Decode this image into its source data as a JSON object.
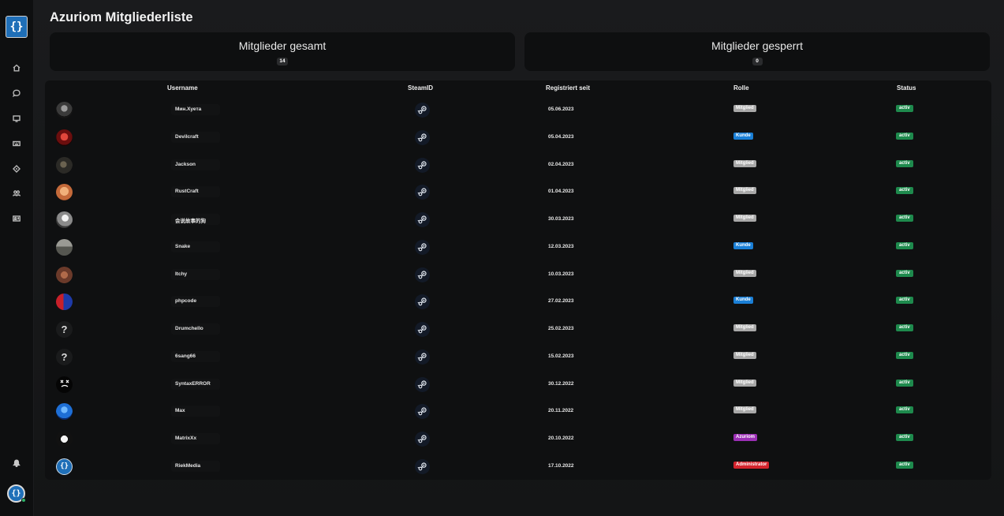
{
  "sidebar": {
    "logo_glyph": "{}",
    "nav_icons": [
      "home-icon",
      "chat-icon",
      "monitor-icon",
      "keyboard-icon",
      "diamond-icon",
      "users-icon",
      "id-card-icon"
    ],
    "bottom_icons": [
      "bell-icon"
    ],
    "user_avatar_glyph": "{}"
  },
  "page": {
    "title": "Azuriom Mitgliederliste"
  },
  "stats": {
    "total": {
      "label": "Mitglieder gesamt",
      "count": "14"
    },
    "banned": {
      "label": "Mitglieder gesperrt",
      "count": "0"
    }
  },
  "table": {
    "headers": {
      "username": "Username",
      "steamid": "SteamID",
      "registered": "Registriert seit",
      "role": "Rolle",
      "status": "Status"
    },
    "rows": [
      {
        "username": "Мин.Хуета",
        "date": "05.06.2023",
        "role": "Mitglied",
        "role_color": "#a8a8a8",
        "status": "activ",
        "avatar": "dark-portrait",
        "avatar_text": ""
      },
      {
        "username": "Devilcraft",
        "date": "05.04.2023",
        "role": "Kunde",
        "role_color": "#1a7fd6",
        "status": "activ",
        "avatar": "red-devil",
        "avatar_text": ""
      },
      {
        "username": "Jackson",
        "date": "02.04.2023",
        "role": "Mitglied",
        "role_color": "#a8a8a8",
        "status": "activ",
        "avatar": "dark-figure",
        "avatar_text": ""
      },
      {
        "username": "RustCraft",
        "date": "01.04.2023",
        "role": "Mitglied",
        "role_color": "#a8a8a8",
        "status": "activ",
        "avatar": "orange-face",
        "avatar_text": ""
      },
      {
        "username": "会说故事的狗",
        "date": "30.03.2023",
        "role": "Mitglied",
        "role_color": "#a8a8a8",
        "status": "activ",
        "avatar": "sketch-portrait",
        "avatar_text": ""
      },
      {
        "username": "Snake",
        "date": "12.03.2023",
        "role": "Kunde",
        "role_color": "#1a7fd6",
        "status": "activ",
        "avatar": "grey-landscape",
        "avatar_text": ""
      },
      {
        "username": "Itchy",
        "date": "10.03.2023",
        "role": "Mitglied",
        "role_color": "#a8a8a8",
        "status": "activ",
        "avatar": "brown-scene",
        "avatar_text": ""
      },
      {
        "username": "phpcode",
        "date": "27.02.2023",
        "role": "Kunde",
        "role_color": "#1a7fd6",
        "status": "activ",
        "avatar": "red-blue-hero",
        "avatar_text": ""
      },
      {
        "username": "Drumchello",
        "date": "25.02.2023",
        "role": "Mitglied",
        "role_color": "#a8a8a8",
        "status": "activ",
        "avatar": "unknown",
        "avatar_text": "?"
      },
      {
        "username": "6sang66",
        "date": "15.02.2023",
        "role": "Mitglied",
        "role_color": "#a8a8a8",
        "status": "activ",
        "avatar": "unknown",
        "avatar_text": "?"
      },
      {
        "username": "SyntaxERROR",
        "date": "30.12.2022",
        "role": "Mitglied",
        "role_color": "#a8a8a8",
        "status": "activ",
        "avatar": "x-eyes-face",
        "avatar_text": ""
      },
      {
        "username": "Max",
        "date": "20.11.2022",
        "role": "Mitglied",
        "role_color": "#a8a8a8",
        "status": "activ",
        "avatar": "blue-figure",
        "avatar_text": ""
      },
      {
        "username": "MatrixXx",
        "date": "20.10.2022",
        "role": "Azuriom",
        "role_color": "#9b2fb5",
        "status": "activ",
        "avatar": "white-mask",
        "avatar_text": ""
      },
      {
        "username": "RiekMedia",
        "date": "17.10.2022",
        "role": "Administrator",
        "role_color": "#d3242d",
        "status": "activ",
        "avatar": "azuriom-logo",
        "avatar_text": ""
      }
    ]
  }
}
